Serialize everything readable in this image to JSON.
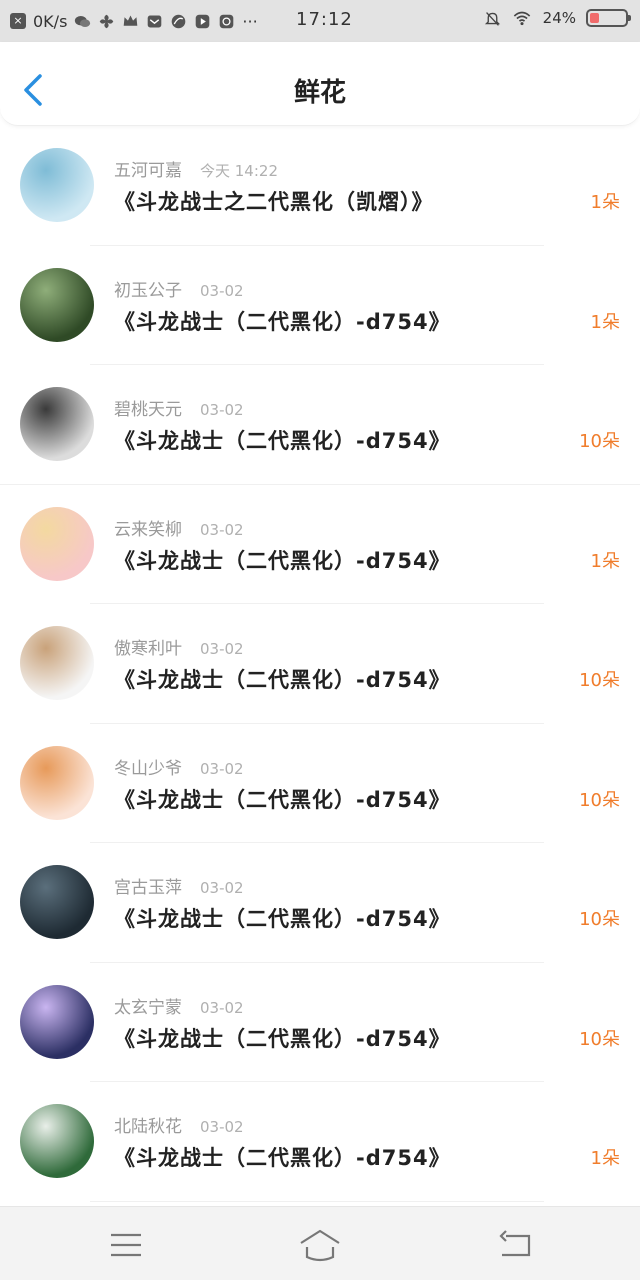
{
  "status_bar": {
    "speed": "0K/s",
    "more": "···",
    "time": "17:12",
    "battery_text": "24%",
    "battery_level": 0.24,
    "icons": [
      "close-box-icon",
      "wechat-icon",
      "fan-icon",
      "crown-icon",
      "mail-icon",
      "leaf-icon",
      "play-icon",
      "chat-icon",
      "bell-off-icon",
      "wifi-icon",
      "battery-icon"
    ]
  },
  "header": {
    "title": "鲜花"
  },
  "items": [
    {
      "name": "五河可嘉",
      "date": "今天 14:22",
      "book": "《斗龙战士之二代黑化（凯熠）》",
      "count": "1朵",
      "avatar_colors": [
        "#cfe8f3",
        "#7fbcd6"
      ]
    },
    {
      "name": "初玉公子",
      "date": "03-02",
      "book": "《斗龙战士（二代黑化）-d754》",
      "count": "1朵",
      "avatar_colors": [
        "#2f4a26",
        "#8fae7a"
      ]
    },
    {
      "name": "碧桃天元",
      "date": "03-02",
      "book": "《斗龙战士（二代黑化）-d754》",
      "count": "10朵",
      "avatar_colors": [
        "#dcdcdc",
        "#3a3a3a"
      ]
    },
    {
      "name": "云来笑柳",
      "date": "03-02",
      "book": "《斗龙战士（二代黑化）-d754》",
      "count": "1朵",
      "avatar_colors": [
        "#f7c8c8",
        "#f3d9a0"
      ]
    },
    {
      "name": "傲寒利叶",
      "date": "03-02",
      "book": "《斗龙战士（二代黑化）-d754》",
      "count": "10朵",
      "avatar_colors": [
        "#f5f5f5",
        "#c9a27a"
      ]
    },
    {
      "name": "冬山少爷",
      "date": "03-02",
      "book": "《斗龙战士（二代黑化）-d754》",
      "count": "10朵",
      "avatar_colors": [
        "#fbe3d6",
        "#e79a5a"
      ]
    },
    {
      "name": "宫古玉萍",
      "date": "03-02",
      "book": "《斗龙战士（二代黑化）-d754》",
      "count": "10朵",
      "avatar_colors": [
        "#1e2a33",
        "#5b6f7c"
      ]
    },
    {
      "name": "太玄宁蒙",
      "date": "03-02",
      "book": "《斗龙战士（二代黑化）-d754》",
      "count": "10朵",
      "avatar_colors": [
        "#2b2f63",
        "#c9b5f0"
      ]
    },
    {
      "name": "北陆秋花",
      "date": "03-02",
      "book": "《斗龙战士（二代黑化）-d754》",
      "count": "1朵",
      "avatar_colors": [
        "#2f6a3a",
        "#e9efe9"
      ]
    }
  ],
  "nav_bar": {
    "buttons": [
      "menu-icon",
      "home-icon",
      "back-icon"
    ]
  },
  "colors": {
    "accent": "#2a8fe0",
    "count": "#f07d2c"
  }
}
